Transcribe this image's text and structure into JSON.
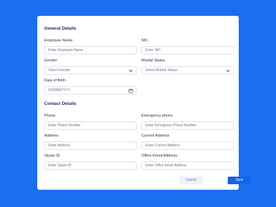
{
  "general": {
    "title": "General Details",
    "employee_name": {
      "label": "Employee Name",
      "placeholder": "Enter Employee Name"
    },
    "nic": {
      "label": "NIC",
      "placeholder": "Enter NIC"
    },
    "gender": {
      "label": "Gender",
      "selected": "Select Gender"
    },
    "marital": {
      "label": "Marital Status",
      "selected": "Select Marital Status"
    },
    "dob": {
      "label": "Date of Birth",
      "placeholder": "DD/MM/YYYY"
    }
  },
  "contact": {
    "title": "Contact Details",
    "phone": {
      "label": "Phone",
      "placeholder": "Enter Phone Number"
    },
    "emergency": {
      "label": "Emergency phone",
      "placeholder": "Enter Emergency Phone Number"
    },
    "address": {
      "label": "Address",
      "placeholder": "Enter Address"
    },
    "current_address": {
      "label": "Current Address",
      "placeholder": "Enter Current Address"
    },
    "skype": {
      "label": "Skype ID",
      "placeholder": "Enter Skype ID"
    },
    "office_email": {
      "label": "Office Email Address",
      "placeholder": "Enter Office Email Address"
    }
  },
  "actions": {
    "cancel": "Cancel",
    "save": "Save"
  },
  "colors": {
    "background": "#1a6ff0",
    "primary": "#1565e6",
    "heading": "#1f2a5c"
  },
  "icons": {
    "dropdown": "chevron-down-icon",
    "date": "calendar-icon"
  }
}
